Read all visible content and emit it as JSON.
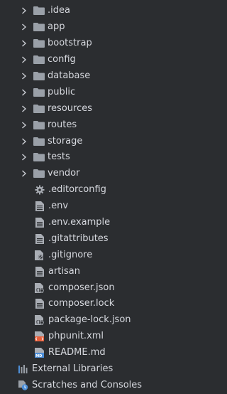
{
  "tree": {
    "folders": [
      {
        "label": ".idea",
        "icon": "folder-icon"
      },
      {
        "label": "app",
        "icon": "folder-icon"
      },
      {
        "label": "bootstrap",
        "icon": "folder-icon"
      },
      {
        "label": "config",
        "icon": "folder-icon"
      },
      {
        "label": "database",
        "icon": "folder-icon"
      },
      {
        "label": "public",
        "icon": "folder-icon"
      },
      {
        "label": "resources",
        "icon": "folder-icon"
      },
      {
        "label": "routes",
        "icon": "folder-icon"
      },
      {
        "label": "storage",
        "icon": "folder-icon"
      },
      {
        "label": "tests",
        "icon": "folder-icon"
      },
      {
        "label": "vendor",
        "icon": "folder-icon"
      }
    ],
    "files": [
      {
        "label": ".editorconfig",
        "icon": "gear-icon"
      },
      {
        "label": ".env",
        "icon": "text-file-icon"
      },
      {
        "label": ".env.example",
        "icon": "text-file-icon"
      },
      {
        "label": ".gitattributes",
        "icon": "text-file-icon"
      },
      {
        "label": ".gitignore",
        "icon": "ignored-file-icon"
      },
      {
        "label": "artisan",
        "icon": "text-file-icon"
      },
      {
        "label": "composer.json",
        "icon": "json-file-icon"
      },
      {
        "label": "composer.lock",
        "icon": "text-file-icon"
      },
      {
        "label": "package-lock.json",
        "icon": "json-file-icon"
      },
      {
        "label": "phpunit.xml",
        "icon": "xml-file-icon"
      },
      {
        "label": "README.md",
        "icon": "markdown-file-icon"
      }
    ],
    "external_libraries": {
      "label": "External Libraries",
      "icon": "library-icon"
    },
    "scratches": {
      "label": "Scratches and Consoles",
      "icon": "scratches-icon"
    }
  },
  "colors": {
    "background": "#2b2d30",
    "text": "#d6d8de",
    "folder": "#9aa0a8",
    "xml": "#e8603c",
    "library": "#4e8fd8"
  }
}
